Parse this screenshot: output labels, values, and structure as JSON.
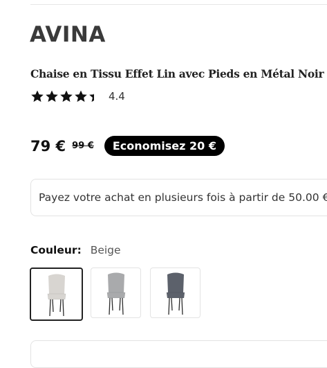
{
  "product": {
    "brand": "AVINA",
    "title": "Chaise en Tissu Effet Lin avec Pieds en Métal Noir",
    "rating": {
      "value": "4.4",
      "stars": 4.4,
      "max": 5
    },
    "price": "79 €",
    "old_price": "99 €",
    "savings_badge": "Economisez 20 €",
    "installments_text": "Payez votre achat en plusieurs fois à partir de 50.00 €",
    "color": {
      "label": "Couleur:",
      "selected": "Beige",
      "swatches": [
        {
          "name": "beige",
          "seat_color": "#d8d5d1",
          "selected": true
        },
        {
          "name": "gris",
          "seat_color": "#a9aaac",
          "selected": false
        },
        {
          "name": "anthracite",
          "seat_color": "#5c616b",
          "selected": false
        }
      ]
    }
  },
  "colors": {
    "badge_bg": "#000000",
    "star": "#111111",
    "border": "#e3e3e3"
  }
}
